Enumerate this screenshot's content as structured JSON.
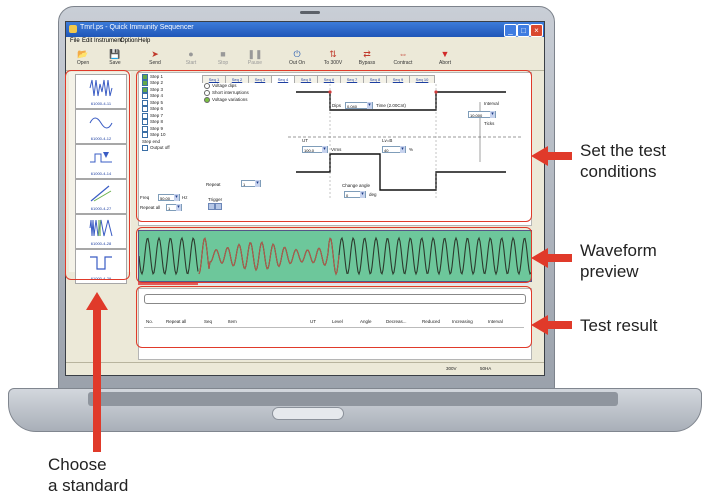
{
  "window": {
    "title": "Tmrl.ps - Quick Immunity Sequencer",
    "controls": [
      "_",
      "□",
      "×"
    ]
  },
  "menu": [
    "File",
    "Edit",
    "Instrument",
    "Option",
    "Help"
  ],
  "toolbar": [
    {
      "label": "Open",
      "icon": "folder-icon",
      "glyph": "📂"
    },
    {
      "label": "Save",
      "icon": "disk-icon",
      "glyph": "💾"
    },
    {
      "label": "Send",
      "icon": "send-icon",
      "glyph": "➤"
    },
    {
      "label": "Start",
      "icon": "start-icon",
      "glyph": "●"
    },
    {
      "label": "Stop",
      "icon": "stop-icon",
      "glyph": "■"
    },
    {
      "label": "Pause",
      "icon": "pause-icon",
      "glyph": "❚❚"
    },
    {
      "label": "Out On",
      "icon": "output-on-icon",
      "glyph": "⏻"
    },
    {
      "label": "To 300V",
      "icon": "range-icon",
      "glyph": "⇅"
    },
    {
      "label": "Bypass",
      "icon": "bypass-icon",
      "glyph": "⇄"
    },
    {
      "label": "Contract",
      "icon": "contract-icon",
      "glyph": "⇔"
    },
    {
      "label": "Abort",
      "icon": "abort-icon",
      "glyph": "▼"
    }
  ],
  "standards": [
    {
      "label": "61000-4-11"
    },
    {
      "label": "61000-4-12"
    },
    {
      "label": "61000-4-14"
    },
    {
      "label": "61000-4-27"
    },
    {
      "label": "61000-4-28"
    },
    {
      "label": "61000-4-29"
    }
  ],
  "conditions": {
    "steps": [
      "Step 1",
      "Step 2",
      "Step 3",
      "Step 4",
      "Step 5",
      "Step 6",
      "Step 7",
      "Step 8",
      "Step 9",
      "Step 10"
    ],
    "steps_checked": [
      true,
      true,
      true,
      false,
      false,
      false,
      false,
      false,
      false,
      false
    ],
    "step_end_label": "Step end",
    "output_off_label": "Output off",
    "freq_label": "Freq",
    "freq_value": "50.00",
    "freq_unit": "Hz",
    "repeat_all_label": "Repeat all",
    "repeat_all_value": "1",
    "modes": [
      "Voltage dips",
      "Short interruptions",
      "Voltage variations"
    ],
    "mode_selected": 2,
    "repeat_label": "Repeat",
    "repeat_value": "1",
    "trigger_label": "Trigger",
    "tabs": [
      "Seq 1",
      "Seq 2",
      "Seq 3",
      "Seq 4",
      "Seq 5",
      "Seq 6",
      "Seq 7",
      "Seq 8",
      "Seq 9",
      "Seq 10"
    ],
    "tab_active": 3,
    "dips_label": "Dips",
    "dips_value": "0.040",
    "dips_unit": "Time (2.00Cnt)",
    "interval_label": "Interval",
    "interval_value": "10.000",
    "interval_unit": "Ticks",
    "ut_label": "UT",
    "ut_value": "100.0",
    "ut_unit": "Vrms",
    "level_label": "Lv=B",
    "level_value": "40",
    "level_unit": "%",
    "change_angle_label": "Change angle",
    "change_angle_value": "0",
    "change_angle_unit": "deg"
  },
  "results": {
    "columns": [
      "No.",
      "Repeat all",
      "Seq",
      "Item",
      "UT",
      "Level",
      "Angle",
      "Decreas...",
      "Reduced",
      "Increasing",
      "Interval"
    ]
  },
  "status": [
    "300V",
    "50HA"
  ],
  "callouts": {
    "conditions": [
      "Set the test",
      "conditions"
    ],
    "waveform": [
      "Waveform",
      "preview"
    ],
    "result": [
      "Test result"
    ],
    "standard": [
      "Choose",
      "a standard"
    ]
  },
  "colors": {
    "accent_red": "#e03a2a",
    "waveform_bg": "#6dc79b",
    "titlebar": "#2a66c8"
  }
}
